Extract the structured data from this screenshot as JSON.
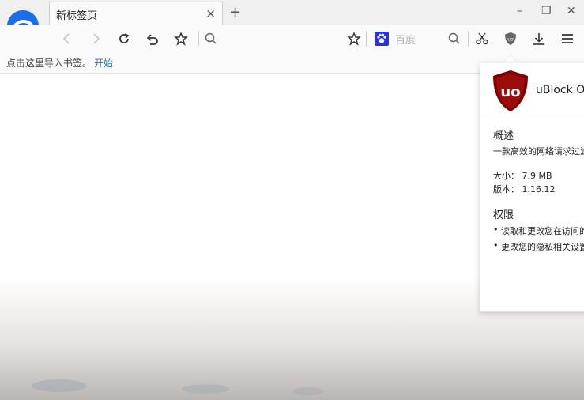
{
  "tab": {
    "title": "新标签页",
    "close": "×",
    "new_tab": "+"
  },
  "window": {
    "minimize": "–",
    "restore": "❐",
    "close": "✕"
  },
  "toolbar": {
    "search_engine_label": "百度"
  },
  "bookmark_bar": {
    "prompt": "点击这里导入书签。",
    "link": "开始"
  },
  "extension_popup": {
    "name": "uBlock Ori",
    "logo_text": "uo",
    "overview_heading": "概述",
    "description": "一款高效的网络请求过滤工",
    "size_line": "大小： 7.9 MB",
    "version_line": "版本： 1.16.12",
    "permissions_heading": "权限",
    "permissions": [
      "读取和更改您在访问的网",
      "更改您的隐私相关设置"
    ]
  },
  "colors": {
    "browser_logo": "#1a6ee8",
    "ublock_red": "#800000",
    "link": "#2d6fd6"
  }
}
